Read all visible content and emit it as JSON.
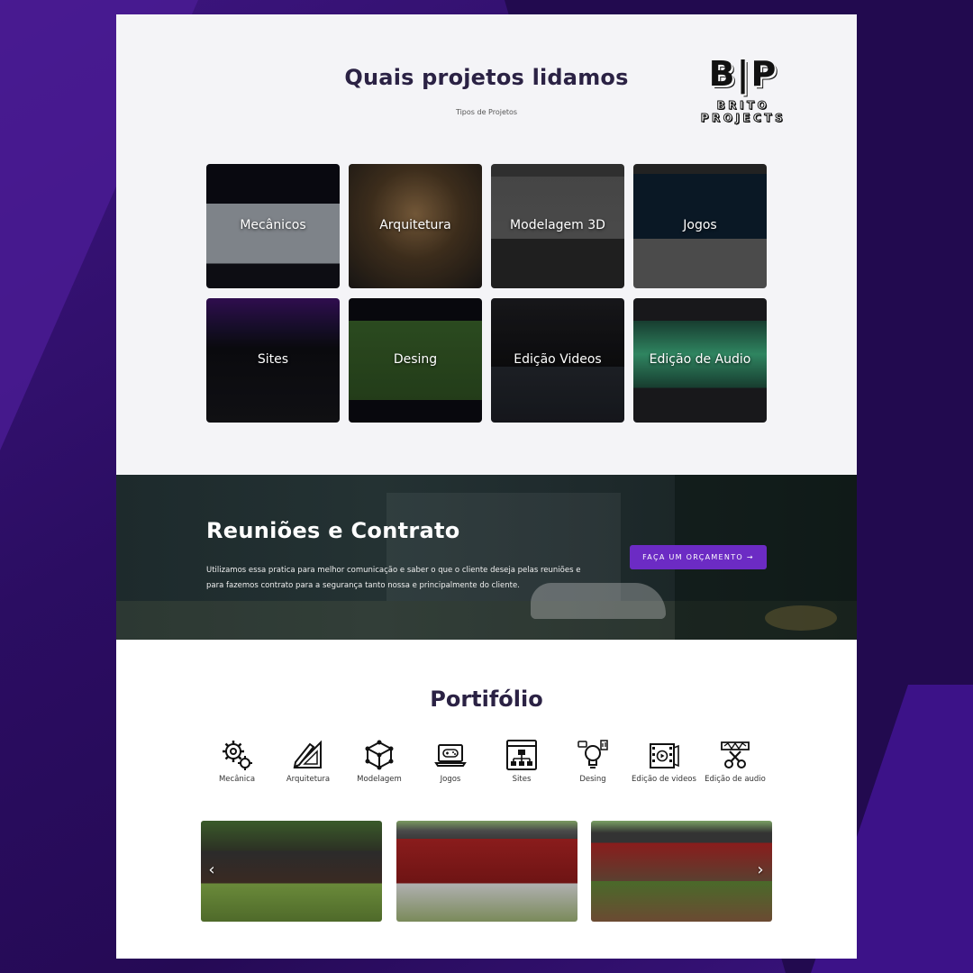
{
  "section1": {
    "title": "Quais projetos lidamos",
    "subtitle": "Tipos de Projetos",
    "logo": {
      "mark": "B|P",
      "text": "BRITO PROJECTS"
    },
    "tiles": [
      {
        "label": "Mecânicos"
      },
      {
        "label": "Arquitetura"
      },
      {
        "label": "Modelagem 3D"
      },
      {
        "label": "Jogos"
      },
      {
        "label": "Sites"
      },
      {
        "label": "Desing"
      },
      {
        "label": "Edição Videos"
      },
      {
        "label": "Edição de Audio"
      }
    ]
  },
  "section2": {
    "title": "Reuniões e Contrato",
    "text": "Utilizamos essa pratica para melhor comunicação e saber o que o cliente deseja pelas reuniões e para fazemos contrato para a segurança tanto nossa e principalmente do cliente.",
    "button": "FAÇA UM ORÇAMENTO →"
  },
  "portfolio": {
    "title": "Portifólio",
    "categories": [
      {
        "label": "Mecânica",
        "icon": "gears-icon"
      },
      {
        "label": "Arquitetura",
        "icon": "ruler-pencil-icon"
      },
      {
        "label": "Modelagem",
        "icon": "cube-icon"
      },
      {
        "label": "Jogos",
        "icon": "laptop-gamepad-icon"
      },
      {
        "label": "Sites",
        "icon": "sitemap-icon"
      },
      {
        "label": "Desing",
        "icon": "lightbulb-icon"
      },
      {
        "label": "Edição de videos",
        "icon": "film-play-icon"
      },
      {
        "label": "Edição de audio",
        "icon": "scissors-icon"
      }
    ],
    "prev": "‹",
    "next": "›"
  },
  "colors": {
    "accent": "#6c2bc4",
    "background": "#2a0f5a",
    "heading": "#2b2244"
  }
}
